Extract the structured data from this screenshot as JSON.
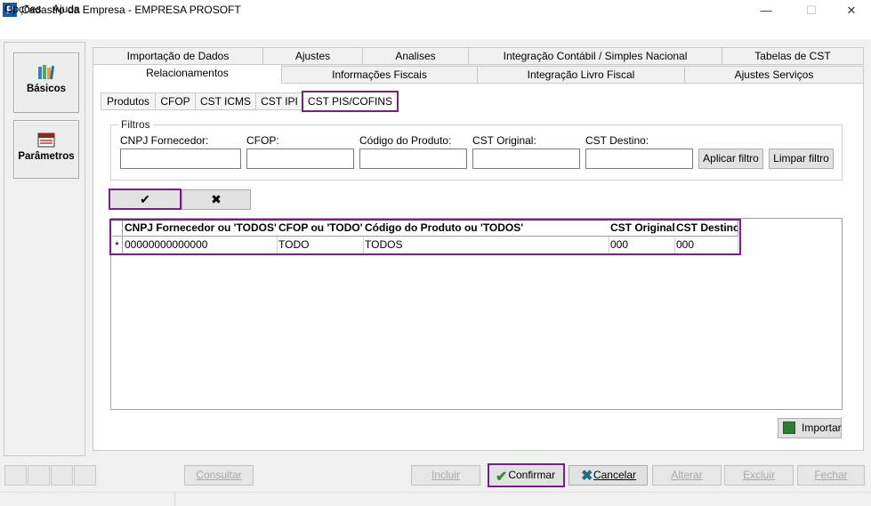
{
  "window": {
    "title": "Cadastro da Empresa - EMPRESA PROSOFT",
    "icon_letter": "P",
    "minimize_glyph": "—",
    "maximize_glyph": "☐",
    "close_glyph": "✕"
  },
  "menu": {
    "opcoes": "Opções",
    "ajuda": "Ajuda"
  },
  "sidebar": {
    "basicos": {
      "label": "Básicos",
      "icon": "books-icon"
    },
    "parametros": {
      "label": "Parâmetros",
      "icon": "calendar-icon"
    }
  },
  "tabs": {
    "row1": [
      "Importação de Dados",
      "Ajustes",
      "Analises",
      "Integração Contábil / Simples Nacional",
      "Tabelas de CST"
    ],
    "row2": [
      "Relacionamentos",
      "Informações Fiscais",
      "Integração Livro Fiscal",
      "Ajustes Serviços"
    ],
    "active": "Relacionamentos"
  },
  "subtabs": {
    "items": [
      "Produtos",
      "CFOP",
      "CST ICMS",
      "CST IPI",
      "CST PIS/COFINS"
    ],
    "active": "CST PIS/COFINS"
  },
  "filters": {
    "legend": "Filtros",
    "cnpj_label": "CNPJ Fornecedor:",
    "cfop_label": "CFOP:",
    "codigo_label": "Código do Produto:",
    "cst_original_label": "CST Original:",
    "cst_destino_label": "CST Destino:",
    "cnpj_value": "",
    "cfop_value": "",
    "codigo_value": "",
    "cst_original_value": "",
    "cst_destino_value": "",
    "apply_label": "Aplicar filtro",
    "clear_label": "Limpar filtro"
  },
  "navigator": {
    "confirm_glyph": "✔",
    "cancel_glyph": "✖"
  },
  "grid": {
    "columns": [
      "CNPJ Fornecedor ou 'TODOS'",
      "CFOP ou 'TODO'",
      "Código do Produto ou 'TODOS'",
      "CST Original",
      "CST Destino"
    ],
    "row_indicator": "*",
    "rows": [
      [
        "00000000000000",
        "TODO",
        "TODOS",
        "000",
        "000"
      ]
    ]
  },
  "import_button": {
    "label": "Importar",
    "icon": "excel-icon"
  },
  "toolbar": {
    "consultar": "Consultar",
    "incluir": "Incluir",
    "confirmar": "Confirmar",
    "cancelar": "Cancelar",
    "alterar": "Alterar",
    "excluir": "Excluir",
    "fechar": "Fechar",
    "confirmar_glyph": "✔",
    "cancelar_glyph": "✖"
  },
  "colors": {
    "highlight": "#7a1f8a",
    "confirm_green": "#2e8b2e",
    "cancel_blue": "#1b6b8c"
  }
}
